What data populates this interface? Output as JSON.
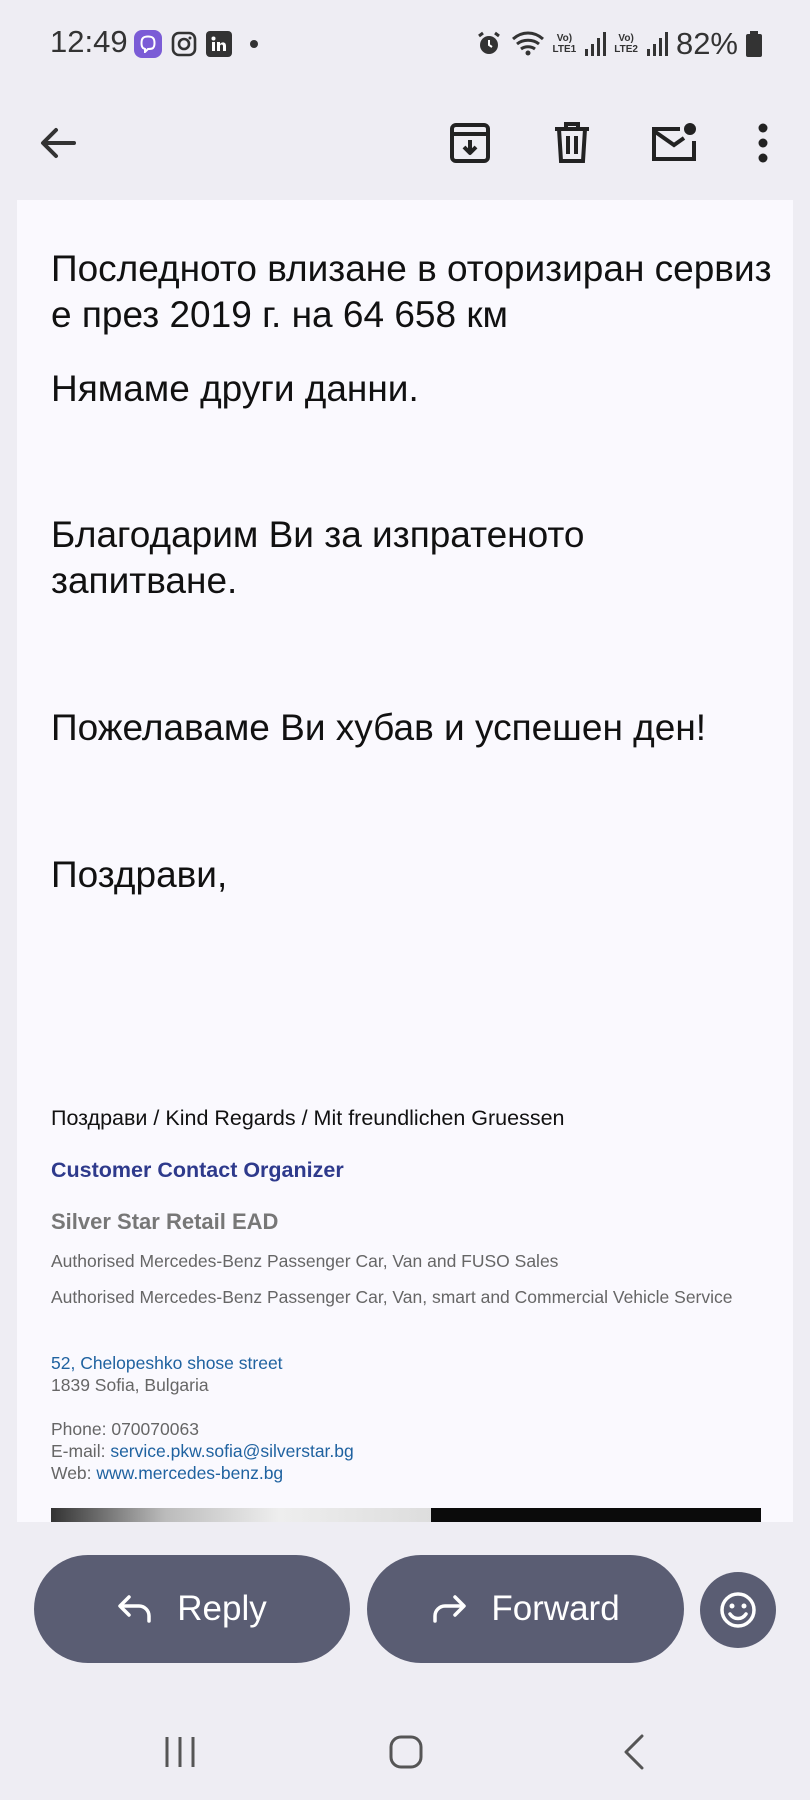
{
  "status_bar": {
    "time": "12:49",
    "battery": "82%",
    "sim1": "Vo)\nLTE1",
    "sim2": "Vo)\nLTE2"
  },
  "email": {
    "paragraph1": "Последното влизане в оторизиран сервиз е през 2019 г. на 64 658 км",
    "paragraph2": "Нямаме други данни.",
    "paragraph3": "Благодарим Ви за изпратеното запитване.",
    "paragraph4": "Пожелаваме Ви хубав и успешен ден!",
    "paragraph5": "Поздрави,"
  },
  "signature": {
    "regards": "Поздрави / Kind Regards / Mit freundlichen Gruessen",
    "title": "Customer Contact Organizer",
    "company": "Silver Star Retail EAD",
    "line1": "Authorised Mercedes-Benz Passenger Car, Van and FUSO Sales",
    "line2": "Authorised Mercedes-Benz Passenger Car, Van, smart and Commercial Vehicle Service",
    "address_street": "52, Chelopeshko shose street",
    "address_city": "1839 Sofia, Bulgaria",
    "phone_label": "Phone:",
    "phone": "070070063",
    "email_label": "E-mail:",
    "email": "service.pkw.sofia@silverstar.bg",
    "web_label": "Web:",
    "web": "www.mercedes-benz.bg"
  },
  "actions": {
    "reply_label": "Reply",
    "forward_label": "Forward"
  },
  "colors": {
    "accent_title": "#2e3a8c",
    "link": "#1f62a0",
    "button_bg": "#5a5d73"
  },
  "icons": [
    "back-arrow-icon",
    "archive-icon",
    "delete-icon",
    "mark-unread-icon",
    "more-options-icon",
    "reply-icon",
    "forward-icon",
    "emoji-icon",
    "recent-apps-icon",
    "home-icon",
    "back-nav-icon"
  ]
}
